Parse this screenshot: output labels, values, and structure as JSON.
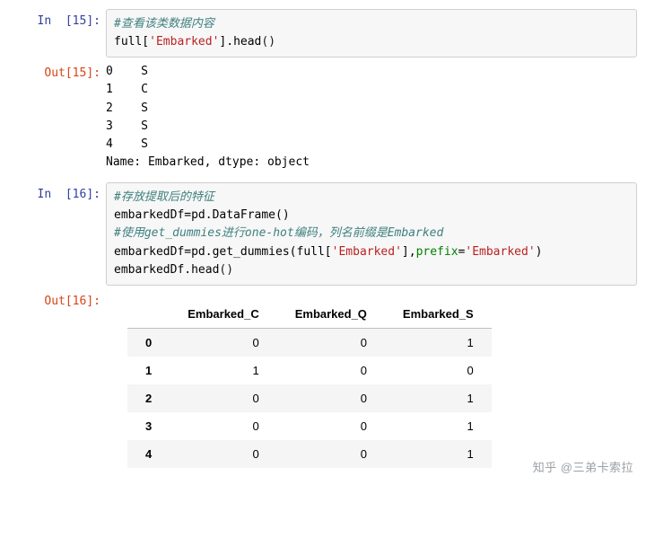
{
  "cell15": {
    "in_prompt": "In  [15]:",
    "out_prompt": "Out[15]:",
    "code": {
      "line1_comment": "#查看该类数据内容",
      "line2_a": "full[",
      "line2_str": "'Embarked'",
      "line2_b": "].head",
      "line2_paren": "()"
    },
    "output_text": "0    S\n1    C\n2    S\n3    S\n4    S\nName: Embarked, dtype: object"
  },
  "cell16": {
    "in_prompt": "In  [16]:",
    "out_prompt": "Out[16]:",
    "code": {
      "line1_comment": "#存放提取后的特征",
      "line2": "embarkedDf=pd.DataFrame()",
      "line3_comment": "#使用get_dummies进行one-hot编码，列名前缀是Embarked",
      "line4_a": "embarkedDf=pd.get_dummies(full[",
      "line4_str1": "'Embarked'",
      "line4_b": "],",
      "line4_kw": "prefix",
      "line4_eq": "=",
      "line4_str2": "'Embarked'",
      "line4_c": ")",
      "line5_a": "embarkedDf.head",
      "line5_paren": "()"
    }
  },
  "chart_data": {
    "type": "table",
    "title": "",
    "columns": [
      "Embarked_C",
      "Embarked_Q",
      "Embarked_S"
    ],
    "index": [
      "0",
      "1",
      "2",
      "3",
      "4"
    ],
    "rows": [
      [
        "0",
        "0",
        "1"
      ],
      [
        "1",
        "0",
        "0"
      ],
      [
        "0",
        "0",
        "1"
      ],
      [
        "0",
        "0",
        "1"
      ],
      [
        "0",
        "0",
        "1"
      ]
    ]
  },
  "watermark": "知乎 @三弟卡索拉"
}
